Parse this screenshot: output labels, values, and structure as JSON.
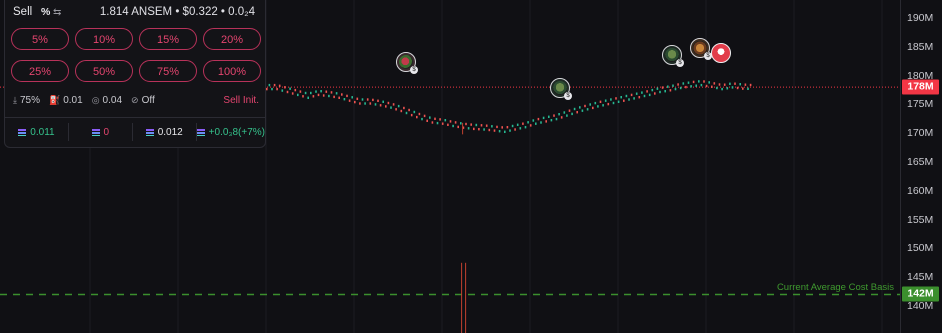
{
  "panel": {
    "mode": "Sell",
    "pct_toggle": "%",
    "summary": "1.814 ANSEM • $0.322 •  0.0₂4",
    "pct_buttons": [
      "5%",
      "10%",
      "15%",
      "20%",
      "25%",
      "50%",
      "75%",
      "100%"
    ],
    "settings": {
      "slippage": "75%",
      "priority": "0.01",
      "bribe": "0.04",
      "mev": "Off"
    },
    "sell_init": "Sell Init.",
    "stats": {
      "bought": "0.011",
      "sold": "0",
      "holding": "0.012",
      "pnl": "+0.0₃8(+7%)"
    }
  },
  "price_axis": {
    "ticks": [
      "190M",
      "185M",
      "180M",
      "175M",
      "170M",
      "165M",
      "160M",
      "155M",
      "150M",
      "145M",
      "140M"
    ],
    "current_label": "178M",
    "current_color": "#f23645",
    "cost_basis_label": "142M",
    "cost_basis_color": "#3b8f2d"
  },
  "cost_basis_text": "Current Average Cost Basis",
  "chart_data": {
    "type": "line",
    "ylim": [
      140,
      190
    ],
    "current_value": 178,
    "cost_basis_value": 142,
    "x": [
      0,
      1,
      2,
      3,
      4,
      5,
      6,
      7,
      8,
      9,
      10,
      11,
      12,
      13,
      14,
      15,
      16,
      17,
      18,
      19,
      20,
      21,
      22,
      23,
      24,
      25,
      26,
      27,
      28,
      29,
      30,
      31,
      32,
      33,
      34,
      35,
      36,
      37,
      38,
      39,
      40,
      41,
      42,
      43,
      44,
      45,
      46
    ],
    "values": [
      178,
      177.5,
      177,
      176.5,
      177,
      176.8,
      176.5,
      176,
      175.5,
      175.5,
      175.2,
      174.8,
      174.2,
      173.5,
      172.8,
      172.2,
      172,
      171.6,
      171.3,
      171.1,
      171,
      170.8,
      170.6,
      171,
      171.4,
      172,
      172.4,
      172.8,
      173.4,
      174,
      174.5,
      175,
      175.4,
      175.8,
      176.2,
      176.6,
      177,
      177.5,
      177.8,
      178.2,
      178.5,
      178.7,
      178.4,
      178,
      178.3,
      178.1,
      178
    ],
    "volume_spike_x": 19
  }
}
